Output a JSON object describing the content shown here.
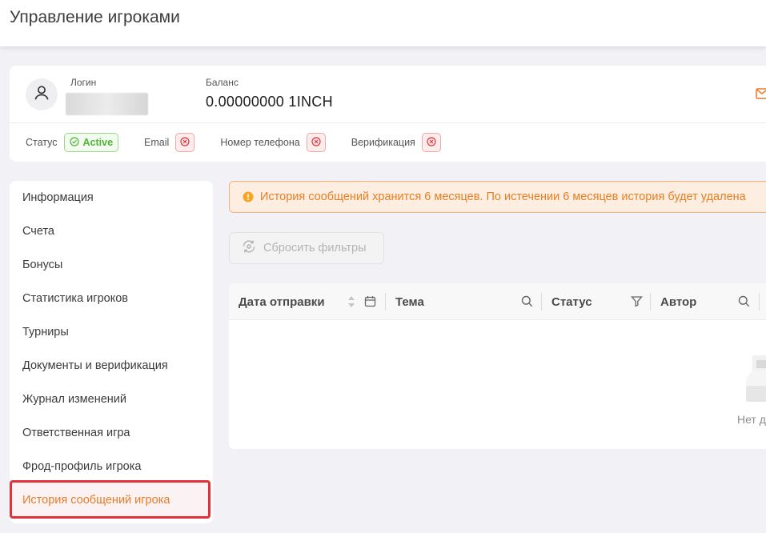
{
  "header": {
    "title": "Управление игроками"
  },
  "player": {
    "login_label": "Логин",
    "balance_label": "Баланс",
    "balance_value": "0.00000000 1INCH",
    "status_label": "Статус",
    "status_value": "Active",
    "email_label": "Email",
    "phone_label": "Номер телефона",
    "verification_label": "Верификация"
  },
  "sidebar": {
    "items": [
      {
        "label": "Информация"
      },
      {
        "label": "Счета"
      },
      {
        "label": "Бонусы"
      },
      {
        "label": "Статистика игроков"
      },
      {
        "label": "Турниры"
      },
      {
        "label": "Документы и верификация"
      },
      {
        "label": "Журнал изменений"
      },
      {
        "label": "Ответственная игра"
      },
      {
        "label": "Фрод-профиль игрока"
      },
      {
        "label": "История сообщений игрока"
      }
    ],
    "active_index": 9
  },
  "notice": {
    "text": "История сообщений хранится 6 месяцев. По истечении 6 месяцев история будет удалена"
  },
  "toolbar": {
    "reset_label": "Сбросить фильтры"
  },
  "table": {
    "columns": [
      {
        "label": "Дата отправки"
      },
      {
        "label": "Тема"
      },
      {
        "label": "Статус"
      },
      {
        "label": "Автор"
      }
    ],
    "empty_text": "Нет д"
  },
  "colors": {
    "accent": "#e87b26",
    "active_green": "#52b436",
    "error_red": "#e0323a",
    "notice_bg": "#fdeee1"
  },
  "icons": [
    "user-icon",
    "mail-icon",
    "check-circle-icon",
    "x-circle-icon",
    "warning-icon",
    "reset-icon",
    "sort-icon",
    "calendar-icon",
    "search-icon",
    "filter-icon",
    "empty-box-icon"
  ]
}
